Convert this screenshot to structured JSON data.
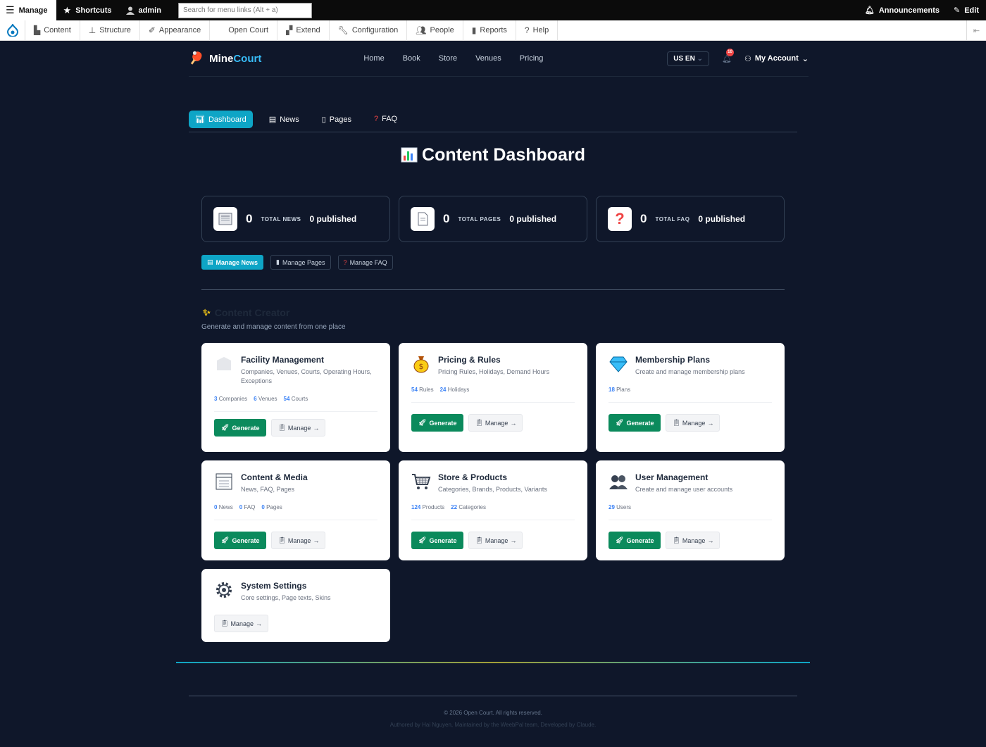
{
  "admin_bar": {
    "manage": "Manage",
    "shortcuts": "Shortcuts",
    "user": "admin",
    "search_placeholder": "Search for menu links (Alt + a)",
    "announcements": "Announcements",
    "edit": "Edit"
  },
  "admin_tray": [
    "Content",
    "Structure",
    "Appearance",
    "Open Court",
    "Extend",
    "Configuration",
    "People",
    "Reports",
    "Help"
  ],
  "site": {
    "logo_a": "Mine",
    "logo_b": "Court",
    "nav": [
      "Home",
      "Book",
      "Store",
      "Venues",
      "Pricing"
    ],
    "lang": "US EN",
    "notif_count": "10",
    "account": "My Account"
  },
  "tabs": [
    "Dashboard",
    "News",
    "Pages",
    "FAQ"
  ],
  "title": "Content Dashboard",
  "stats": [
    {
      "num": "0",
      "label": "TOTAL NEWS",
      "pub": "0 published"
    },
    {
      "num": "0",
      "label": "TOTAL PAGES",
      "pub": "0 published"
    },
    {
      "num": "0",
      "label": "TOTAL FAQ",
      "pub": "0 published"
    }
  ],
  "manage_buttons": [
    "Manage News",
    "Manage Pages",
    "Manage FAQ"
  ],
  "creator": {
    "title": "Content Creator",
    "subtitle": "Generate and manage content from one place"
  },
  "cards": [
    {
      "title": "Facility Management",
      "desc": "Companies, Venues, Courts, Operating Hours, Exceptions",
      "metrics": [
        {
          "n": "3",
          "l": "Companies"
        },
        {
          "n": "6",
          "l": "Venues"
        },
        {
          "n": "54",
          "l": "Courts"
        }
      ]
    },
    {
      "title": "Pricing & Rules",
      "desc": "Pricing Rules, Holidays, Demand Hours",
      "metrics": [
        {
          "n": "54",
          "l": "Rules"
        },
        {
          "n": "24",
          "l": "Holidays"
        }
      ]
    },
    {
      "title": "Membership Plans",
      "desc": "Create and manage membership plans",
      "metrics": [
        {
          "n": "18",
          "l": "Plans"
        }
      ]
    },
    {
      "title": "Content & Media",
      "desc": "News, FAQ, Pages",
      "metrics": [
        {
          "n": "0",
          "l": "News"
        },
        {
          "n": "0",
          "l": "FAQ"
        },
        {
          "n": "0",
          "l": "Pages"
        }
      ]
    },
    {
      "title": "Store & Products",
      "desc": "Categories, Brands, Products, Variants",
      "metrics": [
        {
          "n": "124",
          "l": "Products"
        },
        {
          "n": "22",
          "l": "Categories"
        }
      ]
    },
    {
      "title": "User Management",
      "desc": "Create and manage user accounts",
      "metrics": [
        {
          "n": "29",
          "l": "Users"
        }
      ]
    },
    {
      "title": "System Settings",
      "desc": "Core settings, Page texts, Skins",
      "metrics": []
    }
  ],
  "buttons": {
    "generate": "Generate",
    "manage": "Manage"
  },
  "footer": {
    "copyright": "© 2026 Open Court. All rights reserved.",
    "authored": "Authored by Hai Nguyen, Maintained by the WeebPal team, Developed by Claude."
  }
}
